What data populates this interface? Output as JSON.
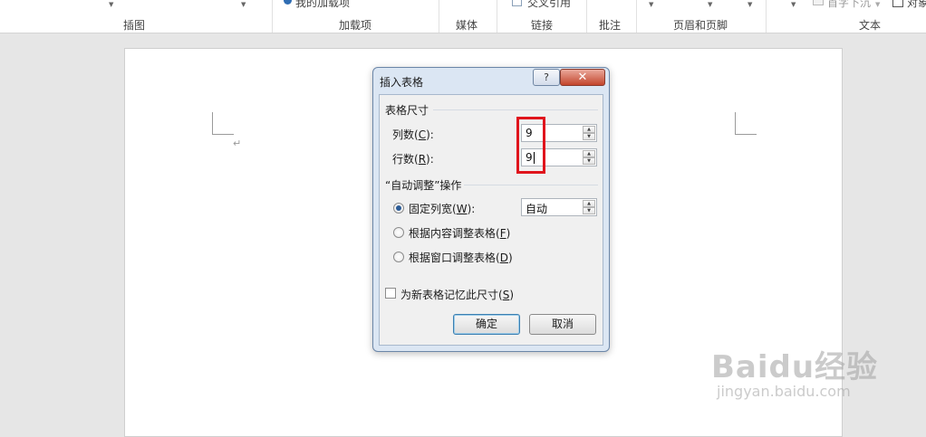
{
  "ribbon": {
    "groups": [
      "插图",
      "加载项",
      "媒体",
      "链接",
      "批注",
      "页眉和页脚",
      "文本"
    ],
    "fragments": {
      "store": "我的加载项",
      "cross_ref": "交叉引用",
      "dropcap": "首字下沉",
      "object": "对象"
    }
  },
  "dialog": {
    "title": "插入表格",
    "help": "?",
    "close": "✕",
    "table_size": {
      "header": "表格尺寸",
      "columns_label": "列数(",
      "columns_key": "C",
      "columns_suffix": "):",
      "columns_value": "9",
      "rows_label": "行数(",
      "rows_key": "R",
      "rows_suffix": "):",
      "rows_value": "9"
    },
    "autofit": {
      "header": "“自动调整”操作",
      "fixed_label": "固定列宽(",
      "fixed_key": "W",
      "fixed_suffix": "):",
      "fixed_value": "自动",
      "content_label": "根据内容调整表格(",
      "content_key": "F",
      "content_suffix": ")",
      "window_label": "根据窗口调整表格(",
      "window_key": "D",
      "window_suffix": ")",
      "selected": "fixed"
    },
    "remember_label": "为新表格记忆此尺寸(",
    "remember_key": "S",
    "remember_suffix": ")",
    "remember_checked": false,
    "ok": "确定",
    "cancel": "取消"
  },
  "page": {
    "paragraph_mark": "↵"
  },
  "watermark": {
    "main": "Baidu经验",
    "sub": "jingyan.baidu.com"
  },
  "colors": {
    "highlight": "#e0141c",
    "radio_dot": "#2b5b96"
  }
}
